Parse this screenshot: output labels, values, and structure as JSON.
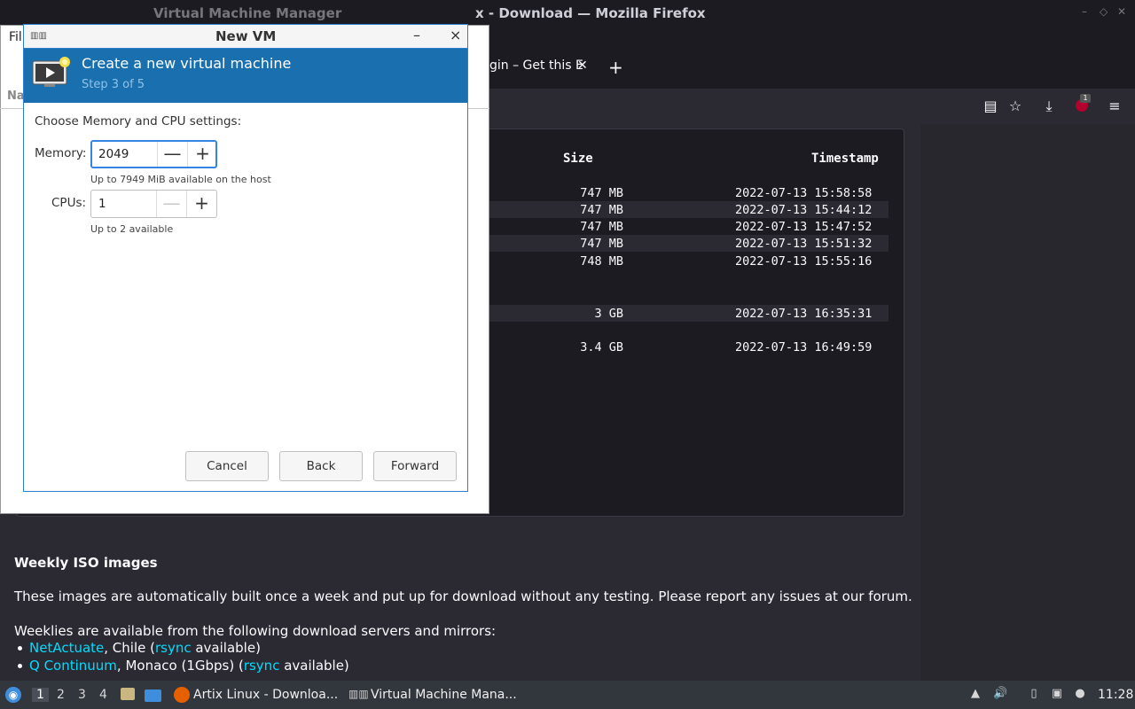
{
  "firefox": {
    "title": "x - Download — Mozilla Firefox",
    "tab": {
      "label": "gin – Get this E",
      "close": "✕"
    },
    "newtab": "+",
    "toolbar": {
      "reader": "▤",
      "bookmark": "☆",
      "download": "⤓",
      "badge": "1",
      "menu": "≡"
    },
    "table": {
      "headers": {
        "size": "Size",
        "timestamp": "Timestamp"
      },
      "rows": [
        {
          "size": "747 MB",
          "ts": "2022-07-13 15:58:58"
        },
        {
          "size": "747 MB",
          "ts": "2022-07-13 15:44:12"
        },
        {
          "size": "747 MB",
          "ts": "2022-07-13 15:47:52"
        },
        {
          "size": "747 MB",
          "ts": "2022-07-13 15:51:32"
        },
        {
          "size": "748 MB",
          "ts": "2022-07-13 15:55:16"
        },
        {
          "size": "3 GB",
          "ts": "2022-07-13 16:35:31"
        },
        {
          "size": "3.4 GB",
          "ts": "2022-07-13 16:49:59"
        }
      ]
    },
    "weekly": {
      "title": "Weekly ISO images",
      "desc": "These images are automatically built once a week and put up for download without any testing. Please report any issues at our forum.",
      "mirrors_intro": "Weeklies are available from the following download servers and mirrors:",
      "mirror1": {
        "name": "NetActuate",
        "mid": ", Chile (",
        "link": "rsync",
        "end": " available)"
      },
      "mirror2": {
        "name": "Q Continuum",
        "mid": ", Monaco (1Gbps) (",
        "link": "rsync",
        "end": " available)"
      }
    }
  },
  "vmm": {
    "title": "Virtual Machine Manager",
    "menu_file": "Fil",
    "header_na": "Na"
  },
  "dialog": {
    "title": "New VM",
    "minimize": "–",
    "close": "×",
    "banner": {
      "title": "Create a new virtual machine",
      "step": "Step 3 of 5"
    },
    "section_label": "Choose Memory and CPU settings:",
    "memory": {
      "label": "Memory:",
      "value": "2049",
      "hint": "Up to 7949 MiB available on the host"
    },
    "cpus": {
      "label": "CPUs:",
      "value": "1",
      "hint": "Up to 2 available"
    },
    "buttons": {
      "cancel": "Cancel",
      "back": "Back",
      "forward": "Forward"
    }
  },
  "taskbar": {
    "workspaces": [
      "1",
      "2",
      "3",
      "4"
    ],
    "firefox_task": "Artix Linux - Downloa...",
    "vmm_task": "Virtual Machine Mana...",
    "clock": "11:28"
  }
}
